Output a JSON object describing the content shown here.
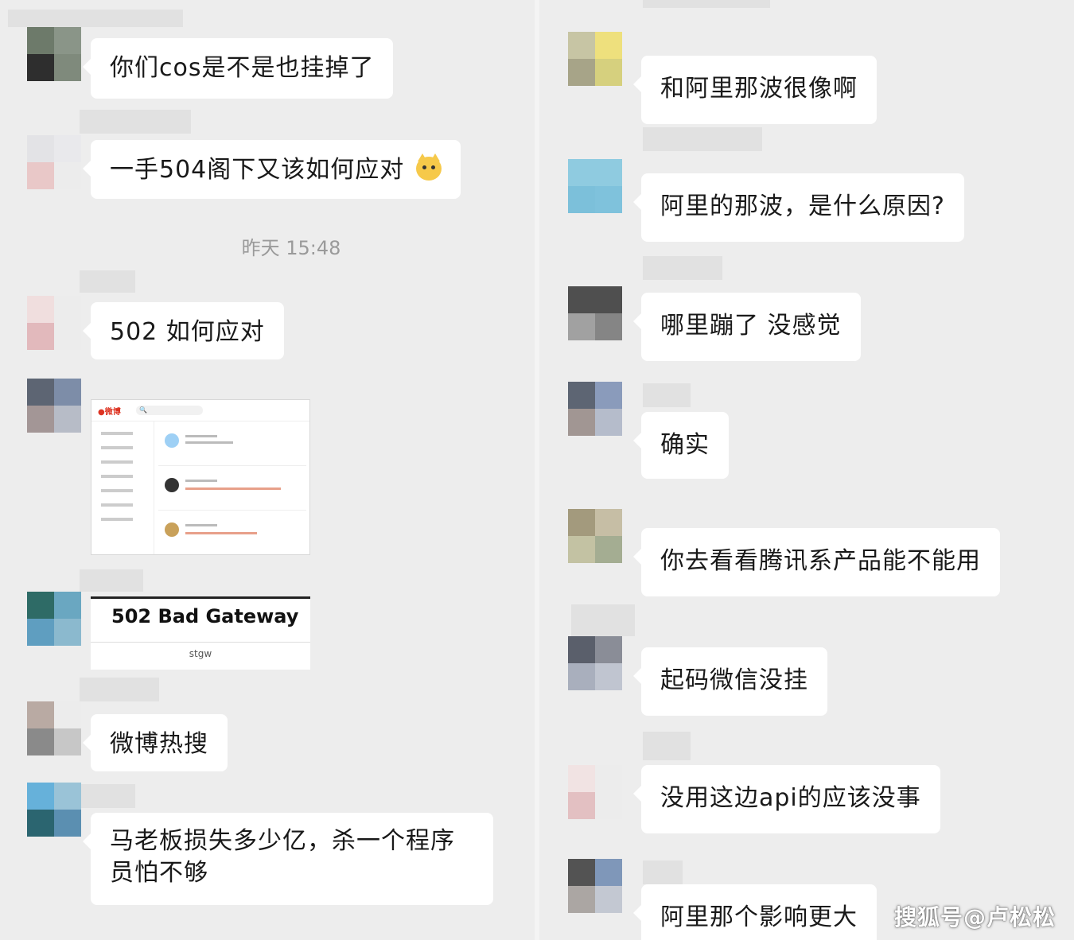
{
  "left_chat": {
    "messages": [
      {
        "text": "你们cos是不是也挂掉了"
      },
      {
        "text": "一手504阁下又该如何应对"
      },
      {
        "text": "502 如何应对"
      },
      {
        "text": "微博热搜"
      },
      {
        "text": "马老板损失多少亿，杀一个程序员怕不够"
      }
    ],
    "timestamp": "昨天 15:48",
    "error_card": {
      "title": "502 Bad Gateway",
      "server": "stgw"
    },
    "emoji_icon": "cat-face-emoji"
  },
  "right_chat": {
    "messages": [
      {
        "text": "和阿里那波很像啊"
      },
      {
        "text": "阿里的那波，是什么原因?"
      },
      {
        "text": "哪里蹦了 没感觉"
      },
      {
        "text": "确实"
      },
      {
        "text": "你去看看腾讯系产品能不能用"
      },
      {
        "text": "起码微信没挂"
      },
      {
        "text": "没用这边api的应该没事"
      },
      {
        "text": "阿里那个影响更大"
      }
    ]
  },
  "watermark": "搜狐号@卢松松"
}
